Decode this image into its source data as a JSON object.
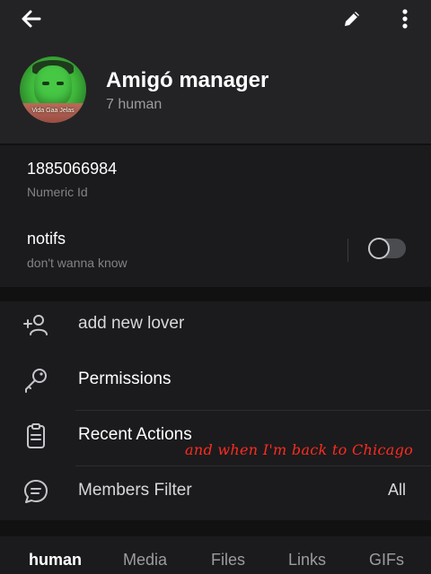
{
  "header": {
    "back_icon": "arrow-left-icon",
    "edit_icon": "pencil-icon",
    "more_icon": "more-vertical-icon"
  },
  "profile": {
    "name": "Amigó manager",
    "subtitle": "7 human",
    "avatar_caption": "Vida Gaa Jelas"
  },
  "info": {
    "id_value": "1885066984",
    "id_label": "Numeric Id",
    "notifs_title": "notifs",
    "notifs_sub": "don't wanna know",
    "notifs_enabled": false
  },
  "actions": [
    {
      "label": "add new lover",
      "icon": "add-user-icon"
    },
    {
      "label": "Permissions",
      "icon": "key-icon"
    },
    {
      "label": "Recent Actions",
      "icon": "clipboard-icon"
    },
    {
      "label": "Members Filter",
      "icon": "chat-bubble-icon",
      "value": "All"
    }
  ],
  "overlay": {
    "caption": "and when I'm back to Chicago",
    "color": "#ff2b1f"
  },
  "tabs": [
    {
      "label": "human",
      "active": true
    },
    {
      "label": "Media",
      "active": false
    },
    {
      "label": "Files",
      "active": false
    },
    {
      "label": "Links",
      "active": false
    },
    {
      "label": "GIFs",
      "active": false
    }
  ]
}
